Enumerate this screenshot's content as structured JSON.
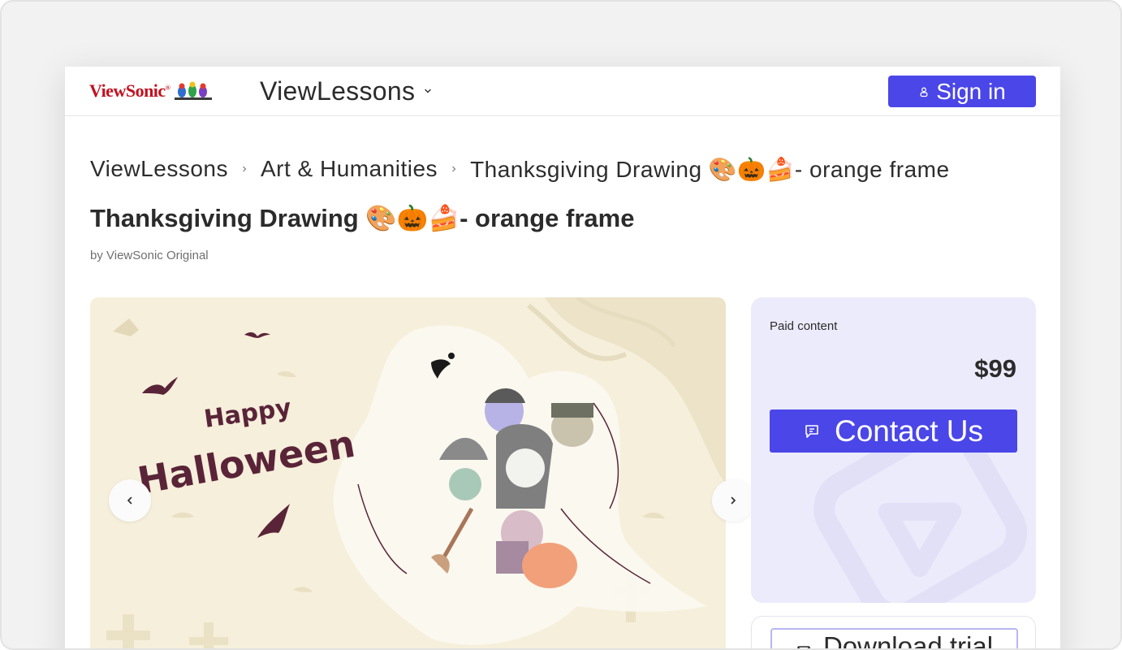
{
  "header": {
    "logo_text": "ViewSonic",
    "logo_mark": "®",
    "product_name": "ViewLessons",
    "signin_label": "Sign in"
  },
  "breadcrumb": {
    "items": [
      "ViewLessons",
      "Art & Humanities"
    ],
    "current": "Thanksgiving Drawing 🎨🎃🍰- orange frame"
  },
  "lesson": {
    "title": "Thanksgiving Drawing 🎨🎃🍰- orange frame",
    "author": "by ViewSonic Original"
  },
  "preview": {
    "greeting_line1": "Happy",
    "greeting_line2": "Halloween"
  },
  "purchase": {
    "paid_label": "Paid content",
    "price": "$99",
    "contact_label": "Contact Us",
    "download_label": "Download trial"
  },
  "colors": {
    "accent": "#4a46e8",
    "brand_red": "#c1121f",
    "card_bg": "#ecebfb",
    "preview_bg": "#f6efdb"
  }
}
